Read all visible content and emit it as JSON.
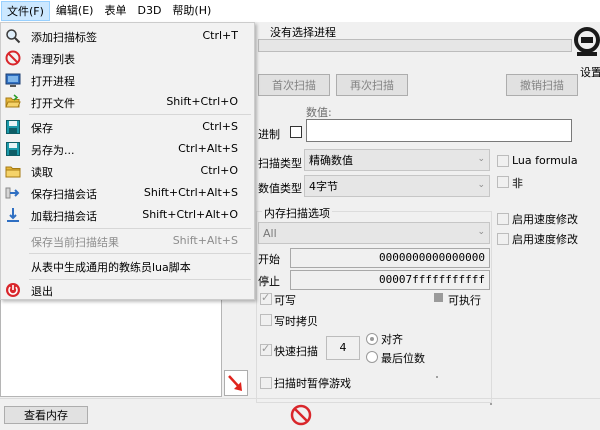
{
  "menubar": {
    "items": [
      "文件(F)",
      "编辑(E)",
      "表单",
      "D3D",
      "帮助(H)"
    ]
  },
  "file_menu": {
    "items": [
      {
        "label": "添加扫描标签",
        "shortcut": "Ctrl+T",
        "icon": "magnifier-icon"
      },
      {
        "label": "清理列表",
        "shortcut": "",
        "icon": "no-entry-icon"
      },
      {
        "label": "打开进程",
        "shortcut": "",
        "icon": "monitor-icon"
      },
      {
        "label": "打开文件",
        "shortcut": "Shift+Ctrl+O",
        "icon": "folder-open-icon"
      },
      {
        "label": "保存",
        "shortcut": "Ctrl+S",
        "icon": "floppy-icon"
      },
      {
        "label": "另存为...",
        "shortcut": "Ctrl+Alt+S",
        "icon": "floppy-icon"
      },
      {
        "label": "读取",
        "shortcut": "Ctrl+O",
        "icon": "folder-icon"
      },
      {
        "label": "保存扫描会话",
        "shortcut": "Shift+Ctrl+Alt+S",
        "icon": "arrow-right-icon"
      },
      {
        "label": "加载扫描会话",
        "shortcut": "Shift+Ctrl+Alt+O",
        "icon": "arrow-down-icon"
      },
      {
        "label": "保存当前扫描结果",
        "shortcut": "Shift+Alt+S",
        "icon": ""
      },
      {
        "label": "从表中生成通用的教练员lua脚本",
        "shortcut": "",
        "icon": ""
      },
      {
        "label": "退出",
        "shortcut": "",
        "icon": "power-icon"
      }
    ]
  },
  "process": {
    "title": "没有选择进程",
    "settings_label": "设置"
  },
  "scan": {
    "first_scan": "首次扫描",
    "next_scan": "再次扫描",
    "undo_scan": "撤销扫描",
    "value_label": "数值:",
    "hex_label": "进制",
    "scan_type_label": "扫描类型",
    "scan_type_value": "精确数值",
    "value_type_label": "数值类型",
    "value_type_value": "4字节",
    "lua_formula": "Lua formula",
    "not_label": "非"
  },
  "memory_options": {
    "title": "内存扫描选项",
    "region": "All",
    "start_label": "开始",
    "start_value": "0000000000000000",
    "stop_label": "停止",
    "stop_value": "00007fffffffffff",
    "writable": "可写",
    "executable": "可执行",
    "copy_on_write": "写时拷贝",
    "fast_scan": "快速扫描",
    "fast_scan_value": "4",
    "align": "对齐",
    "last_digits": "最后位数",
    "pause_game": "扫描时暂停游戏"
  },
  "speed": {
    "enable1": "启用速度修改",
    "enable2": "启用速度修改"
  },
  "bottom": {
    "view_memory": "查看内存"
  },
  "colors": {
    "menu_highlight": "#cce8ff",
    "stop_red": "#d9262b"
  }
}
